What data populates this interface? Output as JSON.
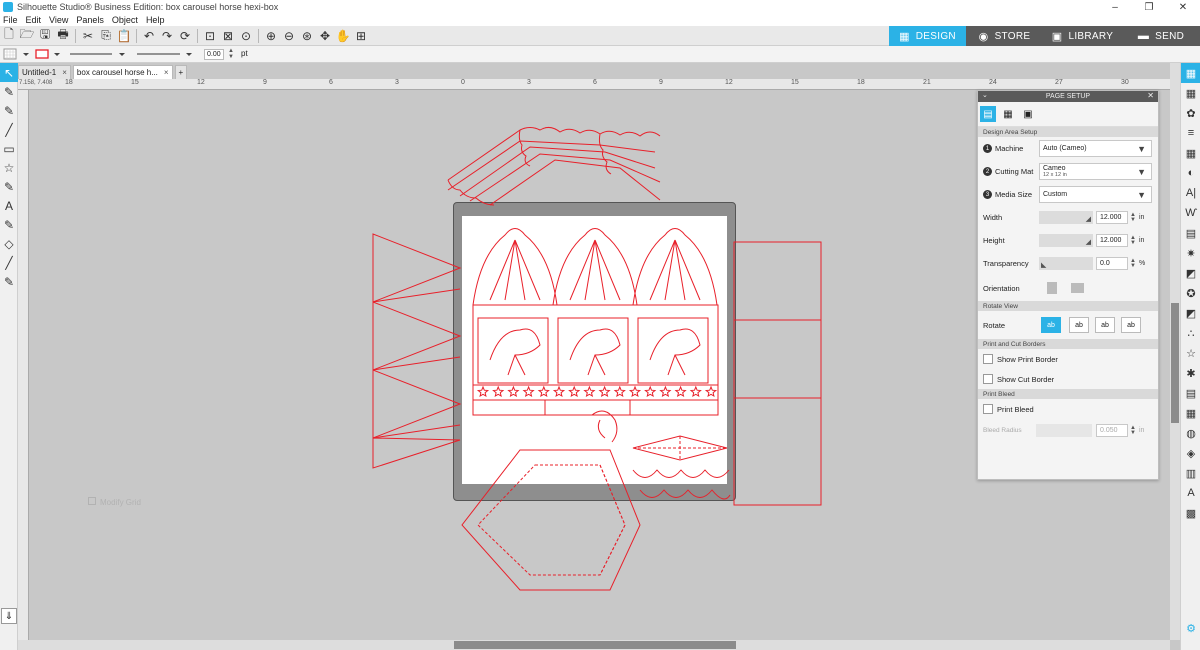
{
  "window": {
    "title": "Silhouette Studio® Business Edition: box carousel horse hexi-box",
    "controls": [
      "–",
      "❐",
      "✕"
    ]
  },
  "menu": [
    "File",
    "Edit",
    "View",
    "Panels",
    "Object",
    "Help"
  ],
  "nav_tabs": [
    {
      "label": "DESIGN",
      "icon": "▦",
      "color": "#2bb2e6"
    },
    {
      "label": "STORE",
      "icon": "◉",
      "color": "#5a5a5a"
    },
    {
      "label": "LIBRARY",
      "icon": "▣",
      "color": "#5a5a5a"
    },
    {
      "label": "SEND",
      "icon": "▬",
      "color": "#5a5a5a"
    }
  ],
  "line_width": {
    "value": "0.00",
    "unit": "pt"
  },
  "doc_tabs": [
    {
      "label": "Untitled-1",
      "close": "×"
    },
    {
      "label": "box carousel horse h...",
      "close": "×"
    },
    {
      "label": "+",
      "close": ""
    }
  ],
  "ruler_numbers": [
    "18",
    "15",
    "12",
    "9",
    "6",
    "3",
    "0",
    "3",
    "6",
    "9",
    "12",
    "15",
    "18",
    "21",
    "24",
    "27",
    "30"
  ],
  "ruler_readout": "7.158, 7.408",
  "page_setup": {
    "title": "PAGE SETUP",
    "section_design_area": "Design Area Setup",
    "machine_label": "Machine",
    "machine_value": "Auto (Cameo)",
    "cutting_mat_label": "Cutting Mat",
    "cutting_mat_value": "Cameo",
    "cutting_mat_sub": "12 x 12 in",
    "media_size_label": "Media Size",
    "media_size_value": "Custom",
    "width_label": "Width",
    "width_value": "12.000",
    "height_label": "Height",
    "height_value": "12.000",
    "unit_in": "in",
    "transparency_label": "Transparency",
    "transparency_value": "0.0",
    "unit_pct": "%",
    "orientation_label": "Orientation",
    "section_rotate": "Rotate View",
    "rotate_label": "Rotate",
    "rotate_options": [
      "ab",
      "ab",
      "ab",
      "ab"
    ],
    "section_print_cut": "Print and Cut Borders",
    "show_print_border": "Show Print Border",
    "show_cut_border": "Show Cut Border",
    "section_print_bleed": "Print Bleed",
    "print_bleed": "Print Bleed",
    "bleed_radius_label": "Bleed Radius",
    "bleed_radius_value": "0.050",
    "badge_numbers": [
      "1",
      "2",
      "3"
    ]
  },
  "canvas_watermark": "Modify Grid",
  "colors": {
    "cut_line": "#e8202a",
    "accent": "#2bb2e6",
    "mat": "#8e8e8e"
  },
  "left_tools": [
    "↖",
    "✎",
    "✎",
    "╱",
    "▭",
    "☆",
    "✎",
    "A",
    "✎",
    "◇",
    "╱",
    "✎"
  ],
  "right_icons": [
    "▦",
    "▦",
    "✿",
    "≡",
    "▦",
    "◐",
    "A|",
    "Ⱳ",
    "▤",
    "✷",
    "◩",
    "✪",
    "◩",
    "∴",
    "☆",
    "✱",
    "▤",
    "▦",
    "◍",
    "◈",
    "▥",
    "A",
    "▩",
    "⚙"
  ],
  "toolbar_icons": [
    "🗋",
    "🗁",
    "🖫",
    "🖶",
    "✂",
    "⎘",
    "📋",
    "↶",
    "↷",
    "⟳",
    "⊡",
    "⊠",
    "⊙",
    "⊕",
    "⊖",
    "⊛",
    "✥",
    "✋",
    "⊞"
  ]
}
